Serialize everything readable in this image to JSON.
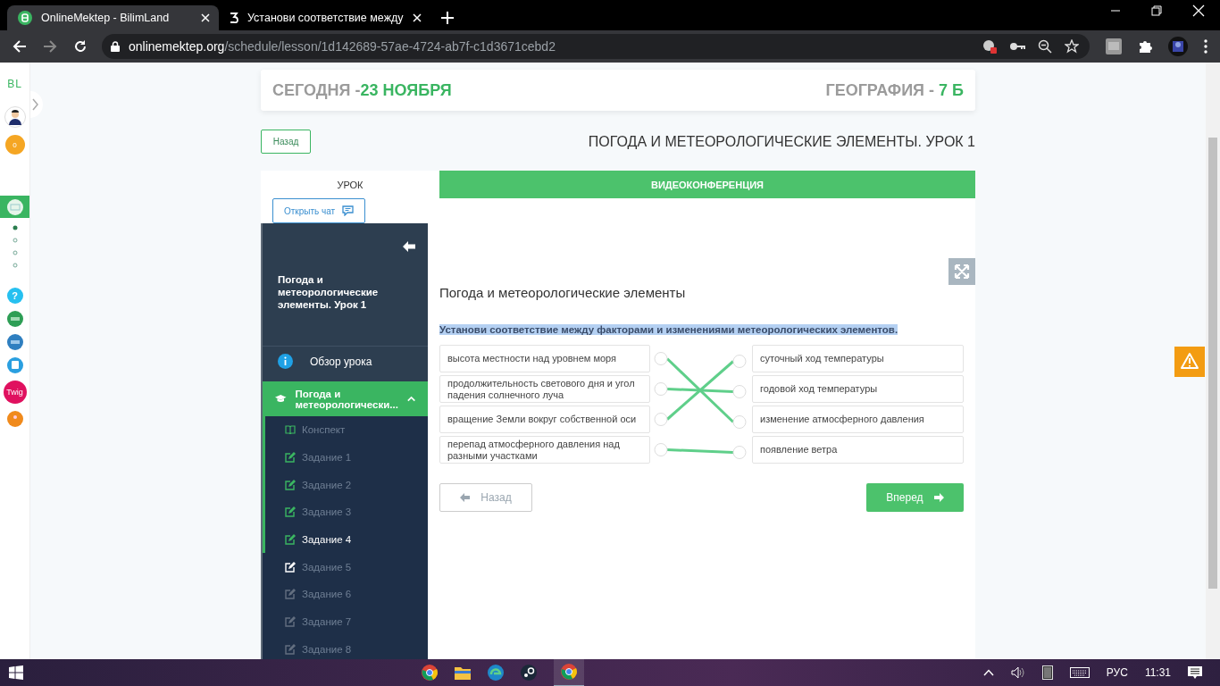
{
  "browser": {
    "tabs": [
      {
        "title": "OnlineMektep - BilimLand",
        "selected": true
      },
      {
        "title": "Установи соответствие между",
        "selected": false
      }
    ],
    "url": {
      "host": "onlinemektep.org",
      "path": "/schedule/lesson/1d142689-57ae-4724-ab7f-c1d3671cebd2"
    }
  },
  "rail": {
    "logo": "BL",
    "points": "0",
    "help": "?",
    "app_label": "Twig"
  },
  "header": {
    "date_label": "СЕГОДНЯ -",
    "date_value": "23 НОЯБРЯ",
    "subject_label": "ГЕОГРАФИЯ - ",
    "subject_value": "7 Б"
  },
  "back_button": "Назад",
  "lesson_title": "ПОГОДА И МЕТЕОРОЛОГИЧЕСКИЕ ЭЛЕМЕНТЫ. УРОК 1",
  "tabs": [
    {
      "label": "УРОК",
      "selected": true
    },
    {
      "label": "ВИДЕОКОНФЕРЕНЦИЯ",
      "selected": false
    }
  ],
  "chat_button": "Открыть чат",
  "menu": {
    "title": "Погода и метеорологические элементы. Урок 1",
    "overview": "Обзор урока",
    "section": {
      "title": "Погода и метеорологически...",
      "expanded": true,
      "items": [
        {
          "kind": "notes",
          "label": "Конспект",
          "completed": true,
          "locked": false,
          "selected": false
        },
        {
          "kind": "task",
          "label": "Задание 1",
          "completed": true,
          "locked": false,
          "selected": false
        },
        {
          "kind": "task",
          "label": "Задание 2",
          "completed": true,
          "locked": false,
          "selected": false
        },
        {
          "kind": "task",
          "label": "Задание 3",
          "completed": true,
          "locked": false,
          "selected": false
        },
        {
          "kind": "task",
          "label": "Задание 4",
          "completed": true,
          "locked": false,
          "selected": true
        },
        {
          "kind": "task",
          "label": "Задание 5",
          "completed": false,
          "locked": false,
          "selected": false
        },
        {
          "kind": "task",
          "label": "Задание 6",
          "completed": false,
          "locked": true,
          "selected": false
        },
        {
          "kind": "task",
          "label": "Задание 7",
          "completed": false,
          "locked": true,
          "selected": false
        },
        {
          "kind": "task",
          "label": "Задание 8",
          "completed": false,
          "locked": true,
          "selected": false
        }
      ]
    }
  },
  "task": {
    "title": "Погода и метеорологические элементы",
    "instruction": "Установи соответствие между факторами и изменениями метеорологических элементов.",
    "instruction_highlighted": true,
    "left": [
      {
        "text": "высота местности над уровнем моря",
        "linked": [
          false,
          false,
          true,
          false
        ]
      },
      {
        "text": "продолжительность светового дня и угол падения солнечного луча",
        "linked": [
          false,
          true,
          false,
          false
        ]
      },
      {
        "text": "вращение Земли вокруг собственной оси",
        "linked": [
          true,
          false,
          false,
          false
        ]
      },
      {
        "text": "перепад атмосферного давления над разными участками",
        "linked": [
          false,
          false,
          false,
          true
        ]
      }
    ],
    "right": [
      {
        "text": "суточный ход температуры"
      },
      {
        "text": "годовой ход температуры"
      },
      {
        "text": "изменение атмосферного давления"
      },
      {
        "text": "появление ветра"
      }
    ],
    "prev_button": {
      "label": "Назад",
      "disabled": true
    },
    "next_button": {
      "label": "Вперед",
      "disabled": false
    }
  },
  "taskbar": {
    "language": "РУС",
    "time": "11:31"
  }
}
